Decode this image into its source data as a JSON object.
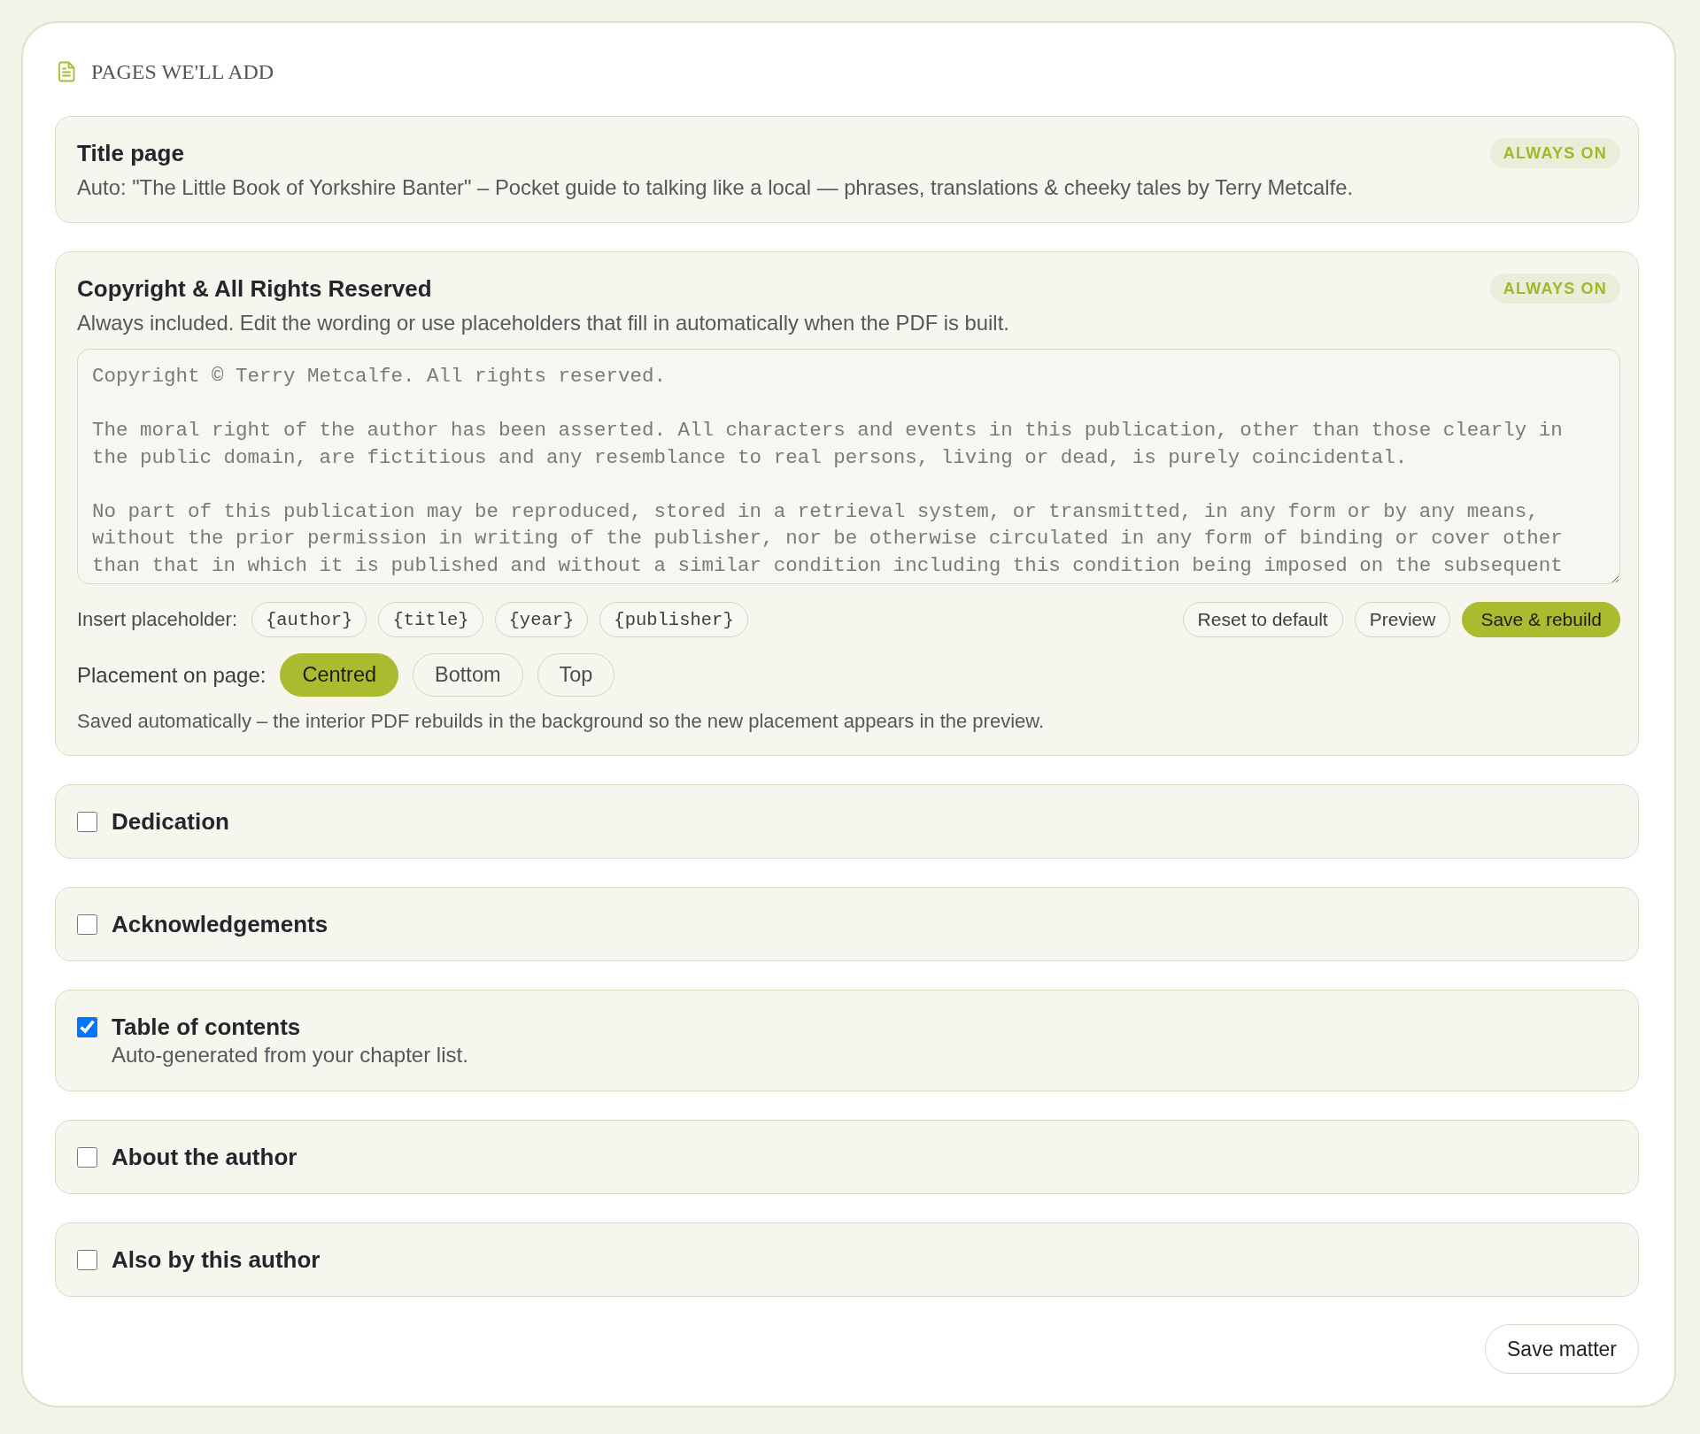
{
  "header": {
    "title": "PAGES WE'LL ADD"
  },
  "pages": [
    {
      "kind": "fixed",
      "title": "Title page",
      "badge": "ALWAYS ON",
      "description": "Auto: \"The Little Book of Yorkshire Banter\" – Pocket guide to talking like a local — phrases, translations & cheeky tales by Terry Metcalfe."
    },
    {
      "kind": "editor",
      "title": "Copyright & All Rights Reserved",
      "badge": "ALWAYS ON",
      "description": "Always included. Edit the wording or use placeholders that fill in automatically when the PDF is built.",
      "text": "Copyright © Terry Metcalfe. All rights reserved.\n\nThe moral right of the author has been asserted. All characters and events in this publication, other than those clearly in the public domain, are fictitious and any resemblance to real persons, living or dead, is purely coincidental.\n\nNo part of this publication may be reproduced, stored in a retrieval system, or transmitted, in any form or by any means, without the prior permission in writing of the publisher, nor be otherwise circulated in any form of binding or cover other than that in which it is published and without a similar condition including this condition being imposed on the subsequent",
      "placeholder_label": "Insert placeholder:",
      "placeholders": [
        "{author}",
        "{title}",
        "{year}",
        "{publisher}"
      ],
      "actions": [
        {
          "label": "Reset to default",
          "kind": "outline"
        },
        {
          "label": "Preview",
          "kind": "outline"
        },
        {
          "label": "Save & rebuild",
          "kind": "primary"
        }
      ],
      "placement": {
        "label": "Placement on page:",
        "options": [
          {
            "label": "Centred",
            "selected": true
          },
          {
            "label": "Bottom",
            "selected": false
          },
          {
            "label": "Top",
            "selected": false
          }
        ]
      },
      "note": "Saved automatically – the interior PDF rebuilds in the background so the new placement appears in the preview."
    },
    {
      "kind": "optional",
      "title": "Dedication",
      "checked": false
    },
    {
      "kind": "optional",
      "title": "Acknowledgements",
      "checked": false
    },
    {
      "kind": "optional",
      "title": "Table of contents",
      "checked": true,
      "description": "Auto-generated from your chapter list."
    },
    {
      "kind": "optional",
      "title": "About the author",
      "checked": false
    },
    {
      "kind": "optional",
      "title": "Also by this author",
      "checked": false
    }
  ],
  "save_button": "Save matter"
}
